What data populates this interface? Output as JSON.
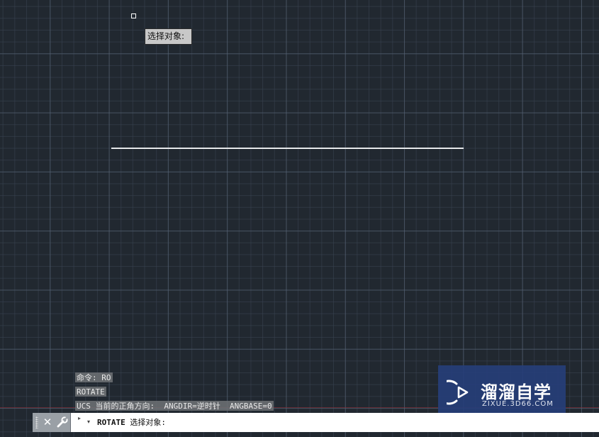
{
  "cursor": {
    "tooltip": "选择对象:"
  },
  "history": {
    "line1": "命令: RO",
    "line2": "ROTATE",
    "line3": "UCS 当前的正角方向:  ANGDIR=逆时针  ANGBASE=0"
  },
  "command_line": {
    "command": "ROTATE",
    "prompt": " 选择对象:",
    "close_icon": "close-icon",
    "settings_icon": "wrench-icon",
    "recent_icon": "recent-commands-icon",
    "dropdown_icon": "dropdown-arrow-icon"
  },
  "watermark": {
    "title": "溜溜自学",
    "subtitle": "ZIXUE.3D66.COM",
    "icon": "play-logo-icon"
  },
  "colors": {
    "canvas_bg": "#212830",
    "line": "#e6e8ea",
    "watermark_bg": "#263e78"
  }
}
